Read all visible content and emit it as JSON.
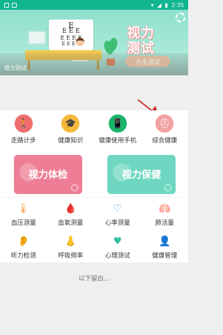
{
  "status_bar": {
    "time": "2:35"
  },
  "banner": {
    "title_line1": "视力",
    "title_line2": "测试",
    "cta": "点击测试",
    "label": "视力测试",
    "eye_chart": [
      "E",
      "E E E",
      "E E E E",
      "E E E E"
    ]
  },
  "features": [
    {
      "label": "走路计步",
      "icon": "walking-person-icon",
      "color": "#ef6d6d",
      "glyph": "🚶"
    },
    {
      "label": "健康知识",
      "icon": "graduation-cap-icon",
      "color": "#f5b93a",
      "glyph": "🎓"
    },
    {
      "label": "健康使用手机",
      "icon": "phone-icon",
      "color": "#19b46a",
      "glyph": "📱"
    },
    {
      "label": "综合健康",
      "icon": "health-kit-icon",
      "color": "#f2a0a3",
      "glyph": "⛑"
    }
  ],
  "cards": {
    "left": {
      "label": "视力体检",
      "color": "#ee7e95"
    },
    "right": {
      "label": "视力保健",
      "color": "#6fd7c1"
    }
  },
  "grid": [
    {
      "label": "血压测量",
      "icon": "thermometer-icon",
      "glyph": "🌡"
    },
    {
      "label": "血氧测量",
      "icon": "blood-drop-icon",
      "glyph": "🩸"
    },
    {
      "label": "心率测量",
      "icon": "heart-rate-icon",
      "glyph": "♡"
    },
    {
      "label": "肺活量",
      "icon": "lungs-icon",
      "glyph": "🫁"
    },
    {
      "label": "听力检测",
      "icon": "ear-icon",
      "glyph": "👂"
    },
    {
      "label": "呼吸频率",
      "icon": "nose-icon",
      "glyph": "👃"
    },
    {
      "label": "心理测试",
      "icon": "heart-circle-icon",
      "glyph": "♥"
    },
    {
      "label": "健康管理",
      "icon": "user-gear-icon",
      "glyph": "👤"
    }
  ],
  "footer_note": "以下留白..."
}
